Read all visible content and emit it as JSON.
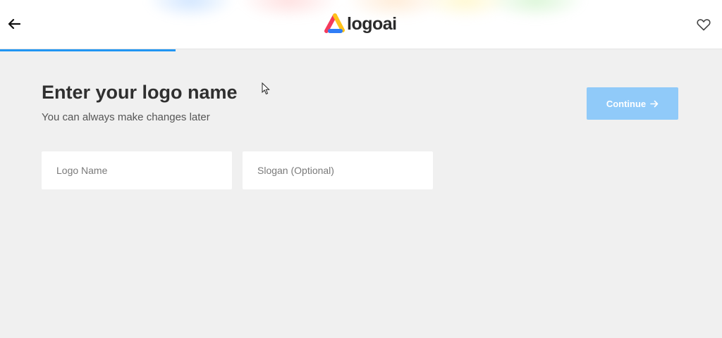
{
  "header": {
    "back_icon": "arrow-left-icon",
    "brand_name": "logoai",
    "favorite_icon": "heart-outline-icon"
  },
  "progress": {
    "fraction": 0.243,
    "color": "#2196f3"
  },
  "main": {
    "title": "Enter your logo name",
    "subtitle": "You can always make changes later",
    "continue_label": "Continue",
    "continue_icon": "arrow-right-icon",
    "continue_color": "#90caf9"
  },
  "form": {
    "logo_name": {
      "value": "",
      "placeholder": "Logo Name"
    },
    "slogan": {
      "value": "",
      "placeholder": "Slogan (Optional)"
    }
  }
}
